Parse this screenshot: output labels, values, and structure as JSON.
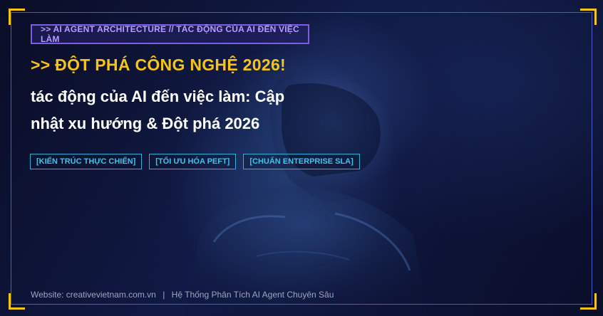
{
  "tag": {
    "label": ">> AI AGENT ARCHITECTURE // TÁC ĐỘNG CỦA AI ĐẾN VIỆC LÀM"
  },
  "headline": ">> ĐỘT PHÁ CÔNG NGHỆ 2026!",
  "title": {
    "line1": "tác động của AI đến việc làm: Cập",
    "line2": "nhật xu hướng & Đột phá 2026"
  },
  "chips": [
    "[KIẾN TRÚC THỰC CHIẾN]",
    "[TỐI ƯU HÓA PEFT]",
    "[CHUẨN ENTERPRISE SLA]"
  ],
  "footer": {
    "website": "Website: creativevietnam.com.vn",
    "separator": "|",
    "tagline": "Hệ Thống Phân Tích AI Agent Chuyên Sâu"
  },
  "colors": {
    "accent_yellow": "#f6c418",
    "frame_blue": "#4a5ac8",
    "tag_purple": "#7b5fe0",
    "chip_cyan": "#3ec3ea",
    "background": "#0b0e2a"
  }
}
